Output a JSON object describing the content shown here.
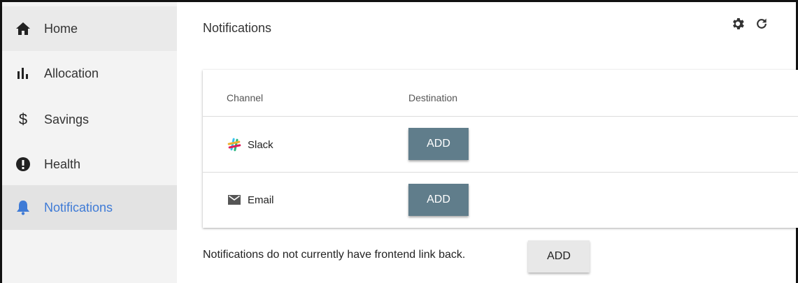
{
  "sidebar": {
    "items": [
      {
        "label": "Home",
        "icon": "home-icon"
      },
      {
        "label": "Allocation",
        "icon": "bar-chart-icon"
      },
      {
        "label": "Savings",
        "icon": "dollar-icon"
      },
      {
        "label": "Health",
        "icon": "alert-circle-icon"
      },
      {
        "label": "Notifications",
        "icon": "bell-icon",
        "active": true
      }
    ],
    "active_color": "#3f7bd6"
  },
  "header": {
    "title": "Notifications",
    "icons": [
      "settings-icon",
      "refresh-icon"
    ]
  },
  "table": {
    "columns": [
      "Channel",
      "Destination"
    ],
    "rows": [
      {
        "channel": "Slack",
        "icon": "slack-icon",
        "button": "ADD"
      },
      {
        "channel": "Email",
        "icon": "email-icon",
        "button": "ADD"
      }
    ],
    "button_color": "#607d8b"
  },
  "footer": {
    "text": "Notifications do not currently have frontend link back.",
    "button": "ADD"
  }
}
